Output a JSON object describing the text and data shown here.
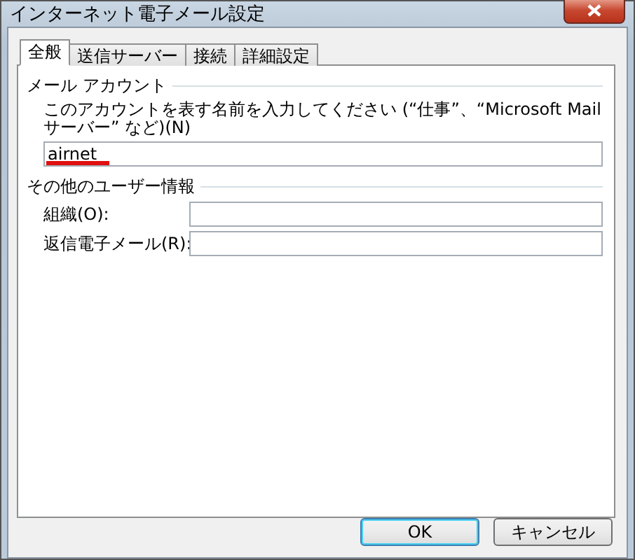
{
  "window": {
    "title": "インターネット電子メール設定"
  },
  "tabs": [
    {
      "label": "全般",
      "selected": true
    },
    {
      "label": "送信サーバー",
      "selected": false
    },
    {
      "label": "接続",
      "selected": false
    },
    {
      "label": "詳細設定",
      "selected": false
    }
  ],
  "mail_account": {
    "heading": "メール アカウント",
    "prompt": "このアカウントを表す名前を入力してください (“仕事”、“Microsoft Mail サーバー” など)(N)",
    "value": "airnet"
  },
  "user_info": {
    "heading": "その他のユーザー情報",
    "fields": [
      {
        "label": "組織(O):"
      },
      {
        "label": "返信電子メール(R):"
      }
    ]
  },
  "buttons": [
    {
      "label": "OK",
      "kind": "default"
    },
    {
      "label": "キャンセル",
      "kind": "normal"
    }
  ]
}
